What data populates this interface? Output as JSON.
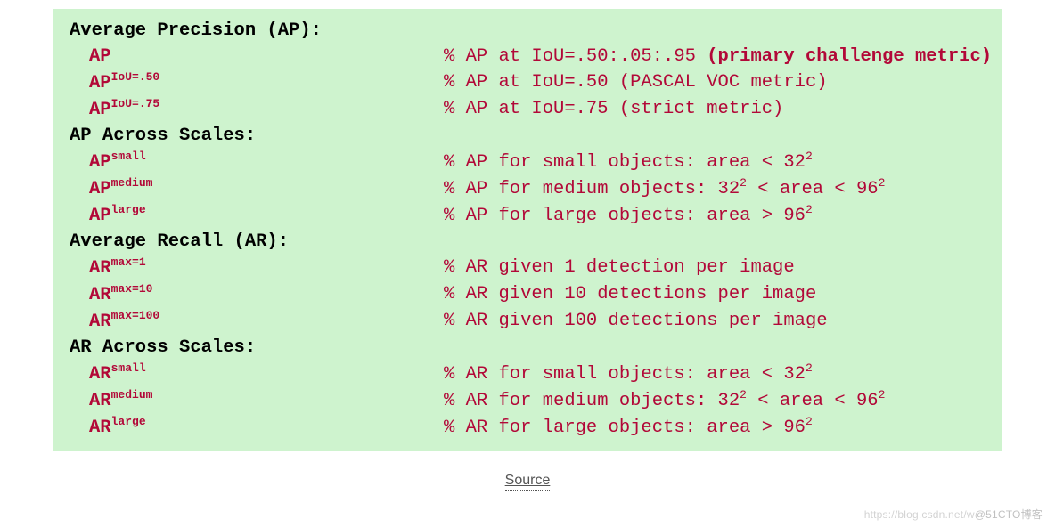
{
  "sections": [
    {
      "title": "Average Precision (AP):",
      "rows": [
        {
          "metric": "AP",
          "sup": "",
          "desc_pre": "% AP at IoU=.50:.05:.95 ",
          "desc_strong": "(primary challenge metric)",
          "desc_post": ""
        },
        {
          "metric": "AP",
          "sup": "IoU=.50",
          "desc_pre": "% AP at IoU=.50 (PASCAL VOC metric)",
          "desc_strong": "",
          "desc_post": ""
        },
        {
          "metric": "AP",
          "sup": "IoU=.75",
          "desc_pre": "% AP at IoU=.75 (strict metric)",
          "desc_strong": "",
          "desc_post": ""
        }
      ]
    },
    {
      "title": "AP Across Scales:",
      "rows": [
        {
          "metric": "AP",
          "sup": "small",
          "desc_pre": "% AP for small objects: area < 32",
          "desc_sup": "2",
          "desc_post": ""
        },
        {
          "metric": "AP",
          "sup": "medium",
          "desc_pre": "% AP for medium objects: 32",
          "desc_sup": "2",
          "desc_mid": " < area < 96",
          "desc_sup2": "2"
        },
        {
          "metric": "AP",
          "sup": "large",
          "desc_pre": "% AP for large objects: area > 96",
          "desc_sup": "2",
          "desc_post": ""
        }
      ]
    },
    {
      "title": "Average Recall (AR):",
      "rows": [
        {
          "metric": "AR",
          "sup": "max=1",
          "desc_pre": "% AR given 1 detection per image",
          "desc_strong": "",
          "desc_post": ""
        },
        {
          "metric": "AR",
          "sup": "max=10",
          "desc_pre": "% AR given 10 detections per image",
          "desc_strong": "",
          "desc_post": ""
        },
        {
          "metric": "AR",
          "sup": "max=100",
          "desc_pre": "% AR given 100 detections per image",
          "desc_strong": "",
          "desc_post": ""
        }
      ]
    },
    {
      "title": "AR Across Scales:",
      "rows": [
        {
          "metric": "AR",
          "sup": "small",
          "desc_pre": "% AR for small objects: area < 32",
          "desc_sup": "2",
          "desc_post": ""
        },
        {
          "metric": "AR",
          "sup": "medium",
          "desc_pre": "% AR for medium objects: 32",
          "desc_sup": "2",
          "desc_mid": " < area < 96",
          "desc_sup2": "2"
        },
        {
          "metric": "AR",
          "sup": "large",
          "desc_pre": "% AR for large objects: area > 96",
          "desc_sup": "2",
          "desc_post": ""
        }
      ]
    }
  ],
  "source_label": "Source",
  "watermark_faint": "https://blog.csdn.net/w",
  "watermark_bold": "@51CTO博客"
}
